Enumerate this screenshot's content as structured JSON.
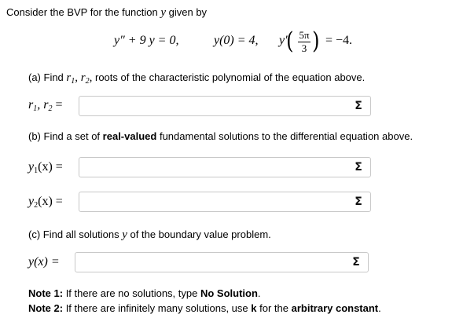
{
  "intro": "Consider the BVP for the function",
  "intro_var": "y",
  "intro_end": "given by",
  "equation": {
    "ode": "y″ + 9 y = 0,",
    "ic1": "y(0) = 4,",
    "ic2_lhs": "y′",
    "ic2_num": "5π",
    "ic2_den": "3",
    "ic2_rhs": "= −4."
  },
  "part_a": {
    "prompt_start": "(a) Find",
    "prompt_end": "roots of the characteristic polynomial of the equation above.",
    "r_label": "r",
    "label": "r",
    "input_value": ""
  },
  "part_b": {
    "prompt_start": "(b) Find a set of",
    "prompt_bold": "real-valued",
    "prompt_end": "fundamental solutions to the differential equation above.",
    "y1_label": "y",
    "y1_args": "(x) =",
    "y2_label": "y",
    "y2_args": "(x) =",
    "y1_value": "",
    "y2_value": ""
  },
  "part_c": {
    "prompt_start": "(c) Find all solutions",
    "prompt_var": "y",
    "prompt_end": "of the boundary value problem.",
    "label": "y(x) =",
    "input_value": ""
  },
  "notes": {
    "note1_label": "Note 1:",
    "note1_text": "If there are no solutions, type",
    "note1_bold": "No Solution",
    "note1_end": ".",
    "note2_label": "Note 2:",
    "note2_text": "If there are infinitely many solutions, use",
    "note2_k": "k",
    "note2_mid": "for the",
    "note2_bold": "arbitrary constant",
    "note2_end": "."
  },
  "sigma_symbol": "Σ",
  "icons": {
    "sigma": "sigma-icon"
  }
}
